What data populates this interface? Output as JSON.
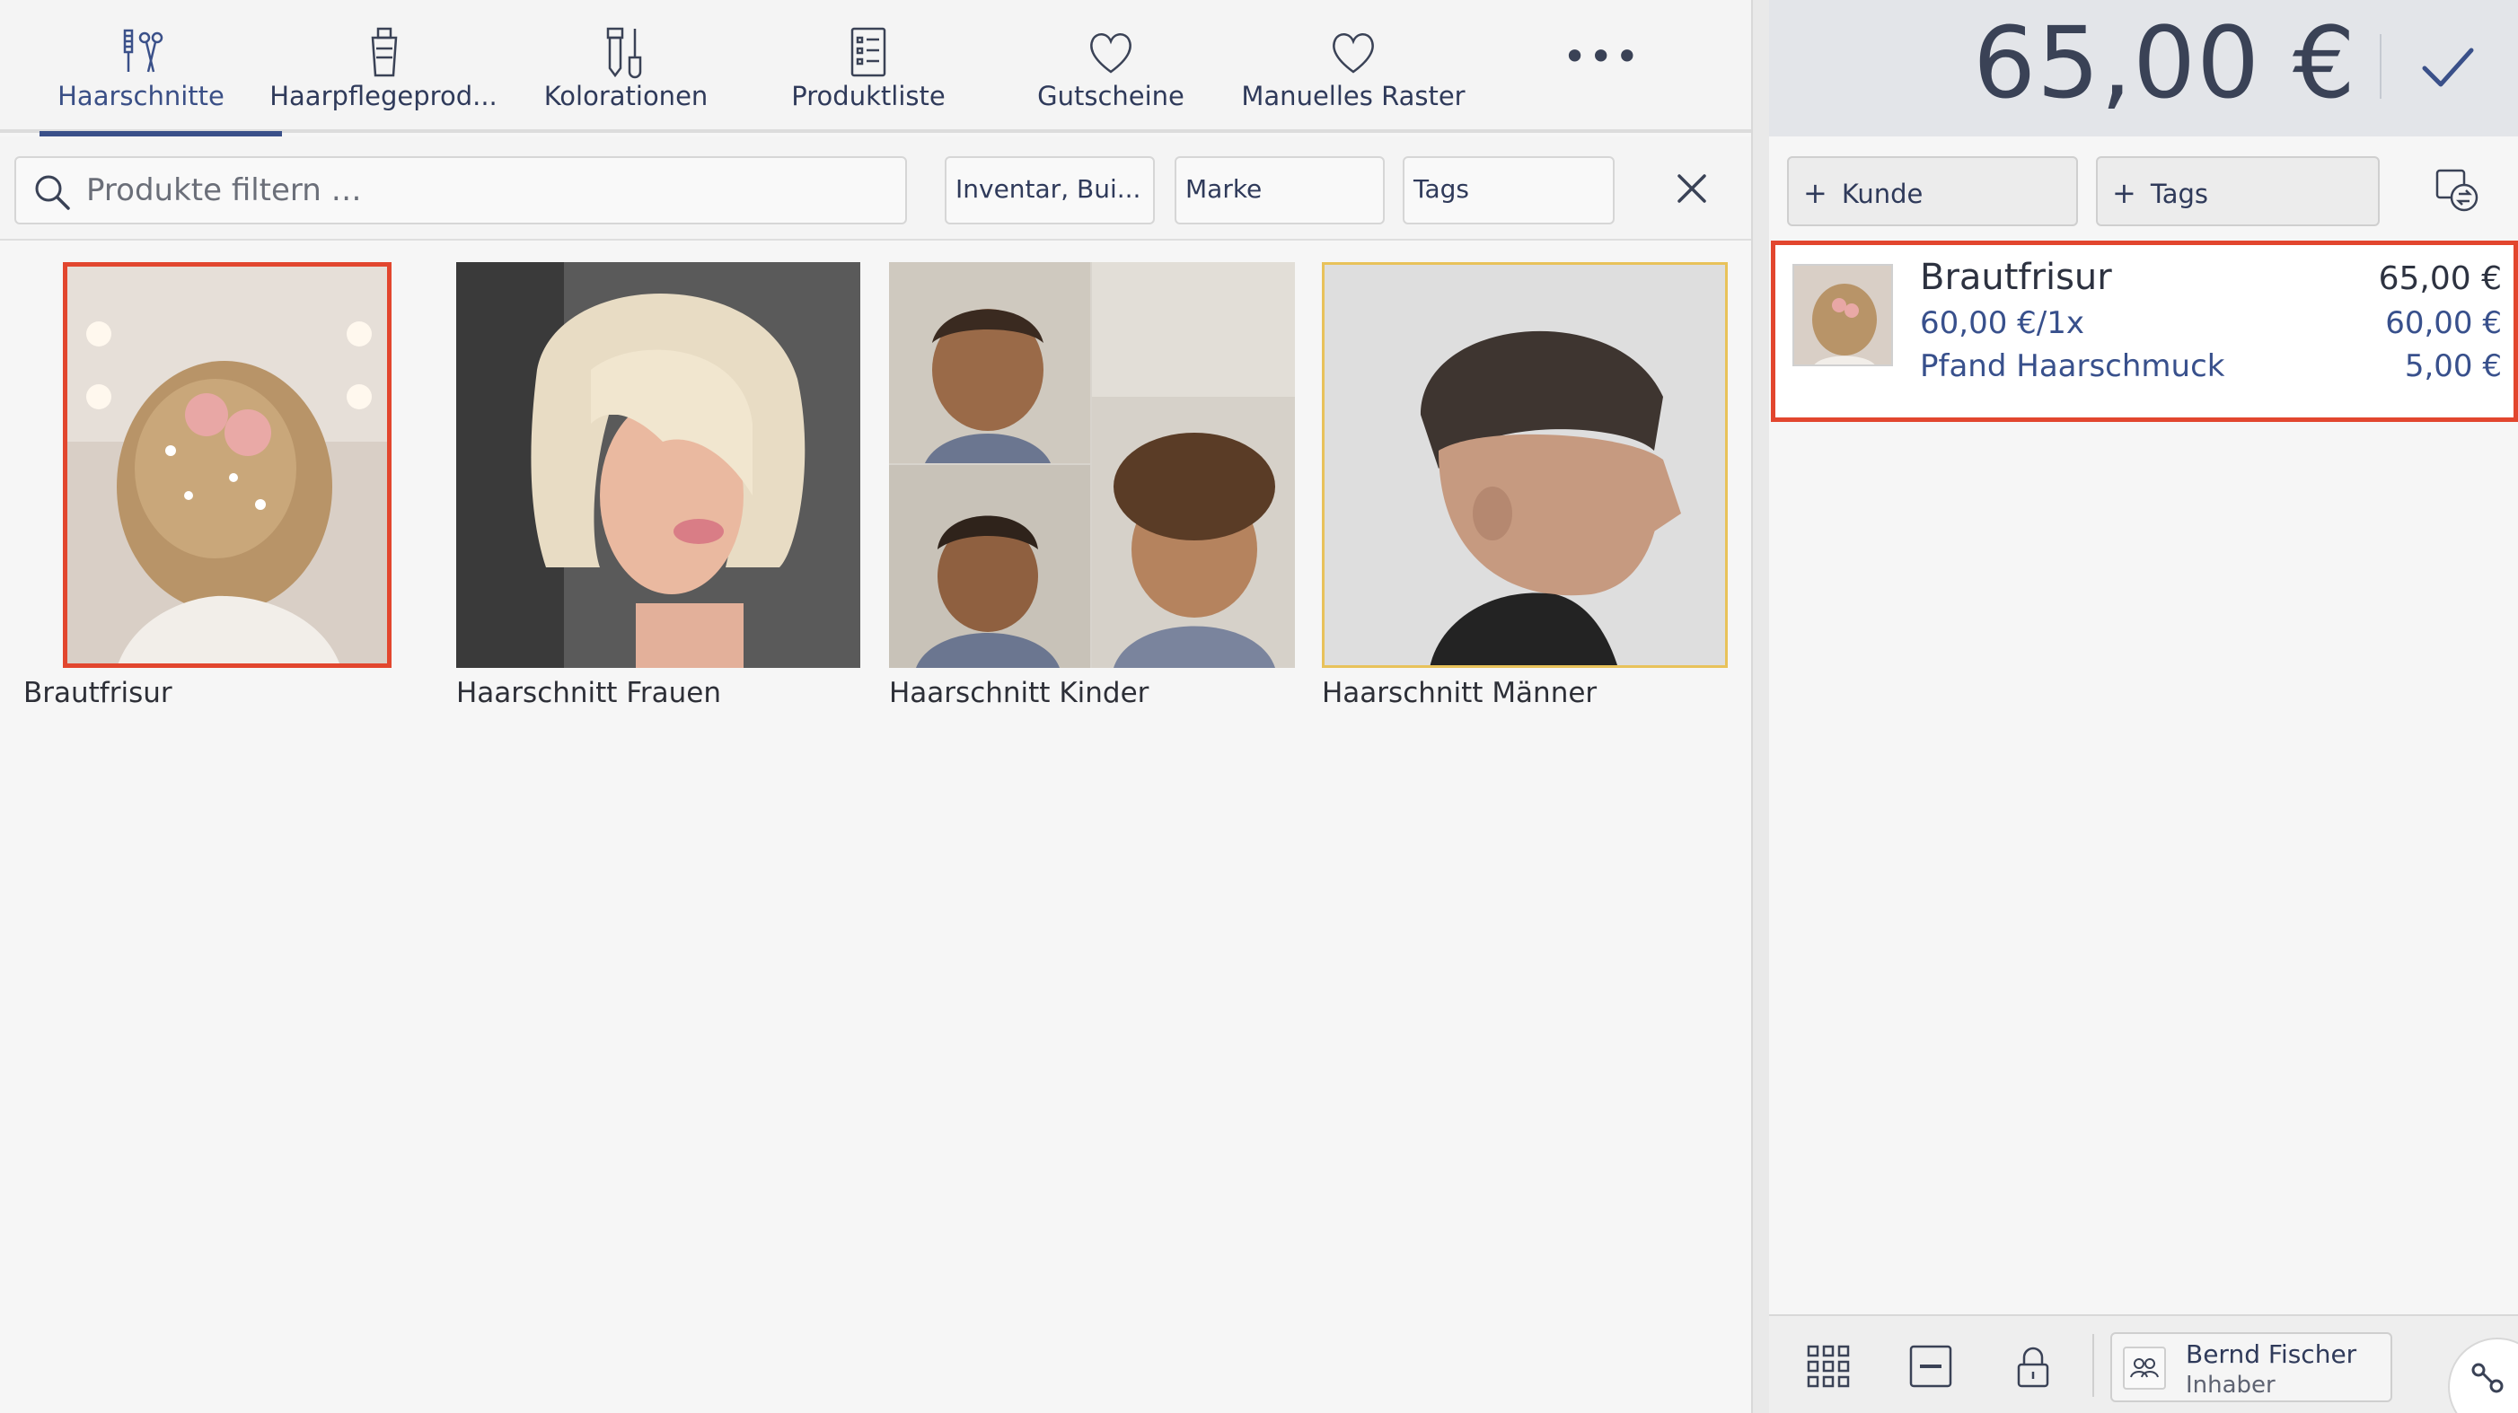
{
  "tabs": [
    {
      "label": "Haarschnitte",
      "icon": "scissors-comb-icon",
      "active": true
    },
    {
      "label": "Haarpflegeprod...",
      "icon": "hair-product-bottle-icon",
      "active": false
    },
    {
      "label": "Kolorationen",
      "icon": "hair-dye-icon",
      "active": false
    },
    {
      "label": "Produktliste",
      "icon": "list-icon",
      "active": false
    },
    {
      "label": "Gutscheine",
      "icon": "heart-icon",
      "active": false
    },
    {
      "label": "Manuelles Raster",
      "icon": "heart-icon",
      "active": false
    }
  ],
  "more_label": "•••",
  "filters": {
    "search_placeholder": "Produkte filtern …",
    "chip_inventory": "Inventar, Bui...",
    "chip_brand": "Marke",
    "chip_tags": "Tags"
  },
  "products": [
    {
      "name": "Brautfrisur",
      "selected": "red"
    },
    {
      "name": "Haarschnitt Frauen",
      "selected": "none"
    },
    {
      "name": "Haarschnitt Kinder",
      "selected": "none"
    },
    {
      "name": "Haarschnitt Männer",
      "selected": "yellow"
    }
  ],
  "cart": {
    "total": "65,00 €",
    "add_customer": "Kunde",
    "add_tags": "Tags",
    "item": {
      "title": "Brautfrisur",
      "price": "65,00 €",
      "unit_line": "60,00 €/1x",
      "unit_price": "60,00 €",
      "extra_line": "Pfand Haarschmuck",
      "extra_price": "5,00 €"
    }
  },
  "user": {
    "name": "Bernd Fischer",
    "role": "Inhaber"
  },
  "colors": {
    "accent": "#3a5089",
    "selection_red": "#e2462e",
    "selection_yellow": "#e8c25a"
  }
}
